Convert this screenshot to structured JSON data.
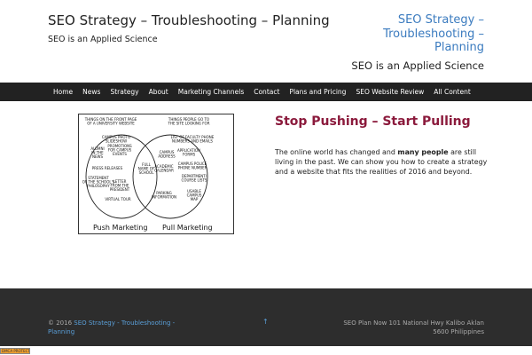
{
  "header": {
    "site_title": "SEO Strategy – Troubleshooting – Planning",
    "site_description": "SEO is an Applied Science",
    "widget_title": "SEO Strategy – Troubleshooting – Planning",
    "widget_description": "SEO is an Applied Science"
  },
  "nav": {
    "items": [
      {
        "label": "Home"
      },
      {
        "label": "News"
      },
      {
        "label": "Strategy"
      },
      {
        "label": "About"
      },
      {
        "label": "Marketing Channels"
      },
      {
        "label": "Contact"
      },
      {
        "label": "Plans and Pricing"
      },
      {
        "label": "SEO Website Review"
      },
      {
        "label": "All Content"
      }
    ]
  },
  "content": {
    "image": {
      "left_header_1": "THINGS ON THE FRONT PAGE",
      "left_header_2": "OF A UNIVERSITY WEBSITE",
      "right_header_1": "THINGS PEOPLE GO TO",
      "right_header_2": "THE SITE LOOKING FOR",
      "left_items": [
        [
          "CAMPUS PHOTO",
          "SLIDESHOW"
        ],
        [
          "ALUMNI",
          "IN THE",
          "NEWS"
        ],
        [
          "PROMOTIONS",
          "FOR CAMPUS",
          "EVENTS"
        ],
        [
          "PRESS RELEASES"
        ],
        [
          "STATEMENT",
          "OF THE SCHOOL'S",
          "PHILOSOPHY"
        ],
        [
          "LETTER",
          "FROM THE",
          "PRESIDENT"
        ],
        [
          "VIRTUAL TOUR"
        ]
      ],
      "center_items": [
        [
          "FULL",
          "NAME OF",
          "SCHOOL"
        ],
        [
          "ACADEMIC",
          "CALENDAR"
        ],
        [
          "CAMPUS",
          "ADDRESS"
        ],
        [
          "PARKING",
          "INFORMATION"
        ]
      ],
      "right_items": [
        [
          "LIST OF FACULTY PHONE",
          "NUMBERS AND EMAILS"
        ],
        [
          "APPLICATION",
          "FORMS"
        ],
        [
          "CAMPUS POLICE",
          "PHONE NUMBER"
        ],
        [
          "DEPARTMENT/",
          "COURSE LISTS"
        ],
        [
          "USABLE",
          "CAMPUS",
          "MAP"
        ]
      ],
      "caption_left": "Push Marketing",
      "caption_right": "Pull Marketing"
    },
    "post_title": "Stop Pushing – Start Pulling",
    "post_body_before": "The online world has changed and ",
    "post_body_strong": "many people",
    "post_body_after": " are still living in the past. We can show you how to create a strategy and a website that fits the realities of 2016 and beyond."
  },
  "footer": {
    "copyright_prefix": "© 2016 ",
    "copyright_link": "SEO Strategy - Troubleshooting - Planning",
    "back_to_top": "↑",
    "address": "SEO Plan Now 101 National Hwy Kalibo Aklan 5600 Philippines"
  },
  "badge": {
    "text": "DMCA PROTECTED"
  },
  "colors": {
    "nav_bg": "#222222",
    "footer_bg": "#2d2d2d",
    "link_blue": "#3b7bbf",
    "post_title": "#8b1a3c"
  }
}
